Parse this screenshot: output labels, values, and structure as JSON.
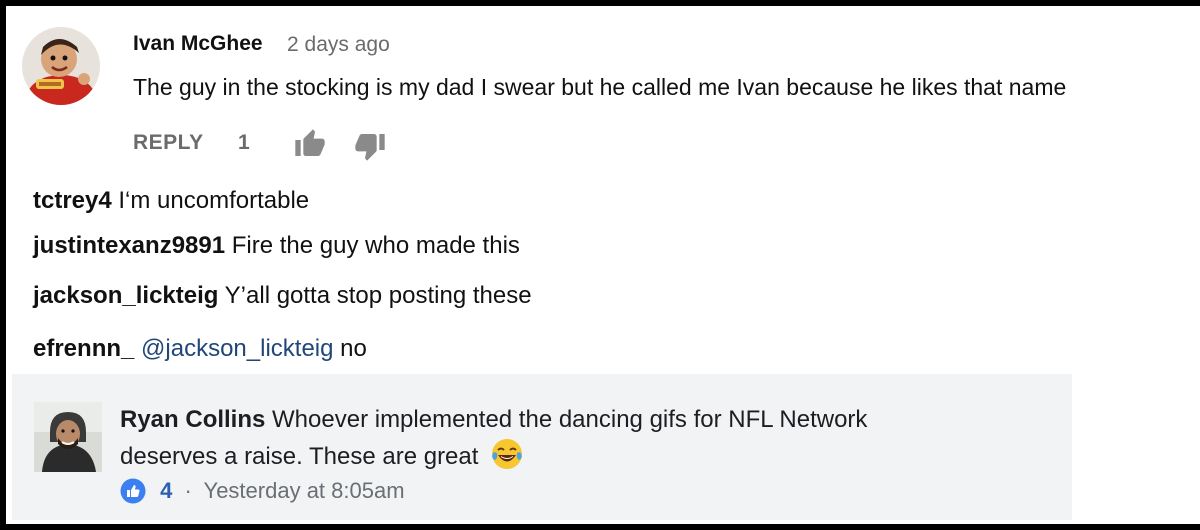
{
  "youtube_comment": {
    "author": "Ivan McGhee",
    "time": "2 days ago",
    "text": "The guy in the stocking is my dad I swear but he called me Ivan because he likes that name",
    "reply_label": "REPLY",
    "like_count": "1",
    "icons": [
      "thumbs-up-icon",
      "thumbs-down-icon"
    ]
  },
  "instagram_comments": [
    {
      "user": "tctrey4",
      "text": "I‘m uncomfortable"
    },
    {
      "user": "justintexanz9891",
      "text": "Fire the guy who made this"
    },
    {
      "user": "jackson_lickteig",
      "text": "Y’all gotta stop posting these"
    },
    {
      "user": "efrennn_",
      "mention": "@jackson_lickteig",
      "text": "no"
    }
  ],
  "facebook_comment": {
    "author": "Ryan Collins",
    "text": "Whoever implemented the dancing gifs for NFL Network deserves a raise. These are great",
    "emoji": "laughing-tears-emoji",
    "reaction_count": "4",
    "separator": "·",
    "time": "Yesterday at 8:05am",
    "colors": {
      "background": "#f2f3f5",
      "like_blue": "#2b5fb4",
      "meta_gray": "#6a6e75"
    }
  }
}
